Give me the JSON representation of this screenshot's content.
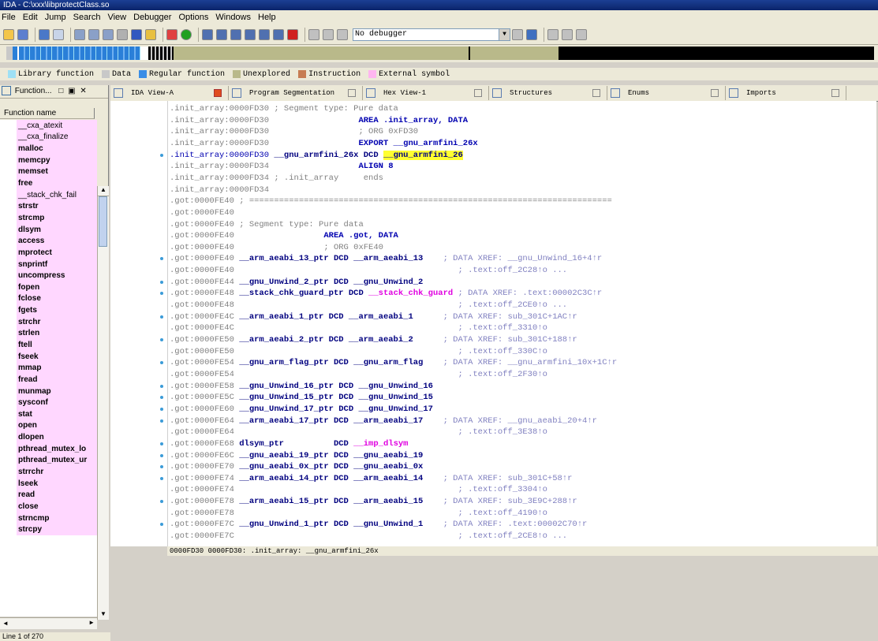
{
  "window": {
    "title": "IDA - C:\\xxx\\libprotectClass.so"
  },
  "menu": [
    "File",
    "Edit",
    "Jump",
    "Search",
    "View",
    "Debugger",
    "Options",
    "Windows",
    "Help"
  ],
  "toolbar": {
    "debugger_select": "No debugger"
  },
  "legend": [
    {
      "label": "Library function",
      "color": "#9ee0f5"
    },
    {
      "label": "Data",
      "color": "#c8c8c8"
    },
    {
      "label": "Regular function",
      "color": "#3a8ee6"
    },
    {
      "label": "Unexplored",
      "color": "#b9b98a"
    },
    {
      "label": "Instruction",
      "color": "#c77c52"
    },
    {
      "label": "External symbol",
      "color": "#ffb6f0"
    }
  ],
  "functions_panel": {
    "title": "Function...",
    "header": "Function name",
    "items": [
      "__cxa_atexit",
      "__cxa_finalize",
      "malloc",
      "memcpy",
      "memset",
      "free",
      "__stack_chk_fail",
      "strstr",
      "strcmp",
      "dlsym",
      "access",
      "mprotect",
      "snprintf",
      "uncompress",
      "fopen",
      "fclose",
      "fgets",
      "strchr",
      "strlen",
      "ftell",
      "fseek",
      "mmap",
      "fread",
      "munmap",
      "sysconf",
      "stat",
      "open",
      "dlopen",
      "pthread_mutex_lo",
      "pthread_mutex_ur",
      "strrchr",
      "lseek",
      "read",
      "close",
      "strncmp",
      "strcpy"
    ],
    "status": "Line 1 of 270"
  },
  "tabs": [
    {
      "label": "IDA View-A",
      "active": true
    },
    {
      "label": "Program Segmentation"
    },
    {
      "label": "Hex View-1"
    },
    {
      "label": "Structures"
    },
    {
      "label": "Enums"
    },
    {
      "label": "Imports"
    }
  ],
  "code_lines": [
    {
      "addr": ".init_array:0000FD30",
      "text": " ; Segment type: Pure data",
      "kind": "cmt"
    },
    {
      "addr": ".init_array:0000FD30",
      "text": "                  AREA .init_array, DATA",
      "kind": "blue"
    },
    {
      "addr": ".init_array:0000FD30",
      "text": "                  ; ORG 0xFD30",
      "kind": "cmt"
    },
    {
      "addr": ".init_array:0000FD30",
      "text": "                  EXPORT __gnu_armfini_26x",
      "kind": "blue"
    },
    {
      "addr": ".init_array:0000FD30",
      "name": " __gnu_armfini_26x DCD ",
      "ref": "__gnu_armfini_26",
      "kind": "sel",
      "dot": true
    },
    {
      "addr": ".init_array:0000FD34",
      "text": "                  ALIGN 8",
      "kind": "blue"
    },
    {
      "addr": ".init_array:0000FD34",
      "text": " ; .init_array     ends",
      "kind": "cmt"
    },
    {
      "addr": ".init_array:0000FD34",
      "text": "",
      "kind": "cmt"
    },
    {
      "addr": ".got:0000FE40",
      "text": " ; =========================================================================",
      "kind": "cmt"
    },
    {
      "addr": ".got:0000FE40",
      "text": "",
      "kind": "cmt"
    },
    {
      "addr": ".got:0000FE40",
      "text": " ; Segment type: Pure data",
      "kind": "cmt"
    },
    {
      "addr": ".got:0000FE40",
      "text": "                  AREA .got, DATA",
      "kind": "blue"
    },
    {
      "addr": ".got:0000FE40",
      "text": "                  ; ORG 0xFE40",
      "kind": "cmt"
    },
    {
      "addr": ".got:0000FE40",
      "name": " __arm_aeabi_13_ptr DCD __arm_aeabi_13",
      "xref": "    ; DATA XREF: __gnu_Unwind_16+4↑r",
      "kind": "code",
      "dot": true
    },
    {
      "addr": ".got:0000FE40",
      "xref": "                                             ; .text:off_2C28↑o ...",
      "kind": "xrefonly"
    },
    {
      "addr": ".got:0000FE44",
      "name": " __gnu_Unwind_2_ptr DCD __gnu_Unwind_2",
      "kind": "code",
      "dot": true
    },
    {
      "addr": ".got:0000FE48",
      "name": " __stack_chk_guard_ptr DCD ",
      "ref": "__stack_chk_guard",
      "xref": " ; DATA XREF: .text:00002C3C↑r",
      "kind": "magref",
      "dot": true
    },
    {
      "addr": ".got:0000FE48",
      "xref": "                                             ; .text:off_2CE0↑o ...",
      "kind": "xrefonly"
    },
    {
      "addr": ".got:0000FE4C",
      "name": " __arm_aeabi_1_ptr DCD __arm_aeabi_1",
      "xref": "      ; DATA XREF: sub_301C+1AC↑r",
      "kind": "code",
      "dot": true
    },
    {
      "addr": ".got:0000FE4C",
      "xref": "                                             ; .text:off_3310↑o",
      "kind": "xrefonly"
    },
    {
      "addr": ".got:0000FE50",
      "name": " __arm_aeabi_2_ptr DCD __arm_aeabi_2",
      "xref": "      ; DATA XREF: sub_301C+188↑r",
      "kind": "code",
      "dot": true
    },
    {
      "addr": ".got:0000FE50",
      "xref": "                                             ; .text:off_330C↑o",
      "kind": "xrefonly"
    },
    {
      "addr": ".got:0000FE54",
      "name": " __gnu_arm_flag_ptr DCD __gnu_arm_flag",
      "xref": "    ; DATA XREF: __gnu_armfini_10x+1C↑r",
      "kind": "code",
      "dot": true
    },
    {
      "addr": ".got:0000FE54",
      "xref": "                                             ; .text:off_2F30↑o",
      "kind": "xrefonly"
    },
    {
      "addr": ".got:0000FE58",
      "name": " __gnu_Unwind_16_ptr DCD __gnu_Unwind_16",
      "kind": "code",
      "dot": true
    },
    {
      "addr": ".got:0000FE5C",
      "name": " __gnu_Unwind_15_ptr DCD __gnu_Unwind_15",
      "kind": "code",
      "dot": true
    },
    {
      "addr": ".got:0000FE60",
      "name": " __gnu_Unwind_17_ptr DCD __gnu_Unwind_17",
      "kind": "code",
      "dot": true
    },
    {
      "addr": ".got:0000FE64",
      "name": " __arm_aeabi_17_ptr DCD __arm_aeabi_17",
      "xref": "    ; DATA XREF: __gnu_aeabi_20+4↑r",
      "kind": "code",
      "dot": true
    },
    {
      "addr": ".got:0000FE64",
      "xref": "                                             ; .text:off_3E38↑o",
      "kind": "xrefonly"
    },
    {
      "addr": ".got:0000FE68",
      "name": " dlsym_ptr          DCD ",
      "ref": "__imp_dlsym",
      "kind": "magref",
      "dot": true
    },
    {
      "addr": ".got:0000FE6C",
      "name": " __gnu_aeabi_19_ptr DCD __gnu_aeabi_19",
      "kind": "code",
      "dot": true
    },
    {
      "addr": ".got:0000FE70",
      "name": " __gnu_aeabi_0x_ptr DCD __gnu_aeabi_0x",
      "kind": "code",
      "dot": true
    },
    {
      "addr": ".got:0000FE74",
      "name": " __arm_aeabi_14_ptr DCD __arm_aeabi_14",
      "xref": "    ; DATA XREF: sub_301C+58↑r",
      "kind": "code",
      "dot": true
    },
    {
      "addr": ".got:0000FE74",
      "xref": "                                             ; .text:off_3304↑o",
      "kind": "xrefonly"
    },
    {
      "addr": ".got:0000FE78",
      "name": " __arm_aeabi_15_ptr DCD __arm_aeabi_15",
      "xref": "    ; DATA XREF: sub_3E9C+288↑r",
      "kind": "code",
      "dot": true
    },
    {
      "addr": ".got:0000FE78",
      "xref": "                                             ; .text:off_4190↑o",
      "kind": "xrefonly"
    },
    {
      "addr": ".got:0000FE7C",
      "name": " __gnu_Unwind_1_ptr DCD __gnu_Unwind_1",
      "xref": "    ; DATA XREF: .text:00002C70↑r",
      "kind": "code",
      "dot": true
    },
    {
      "addr": ".got:0000FE7C",
      "xref": "                                             ; .text:off_2CE8↑o ...",
      "kind": "xrefonly"
    }
  ],
  "statusbar": "0000FD30 0000FD30: .init_array: __gnu_armfini_26x"
}
